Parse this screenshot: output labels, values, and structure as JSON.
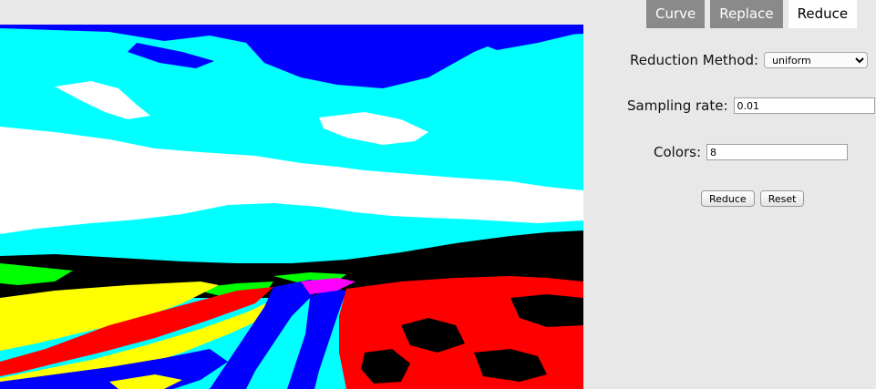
{
  "tabs": [
    {
      "label": "Curve"
    },
    {
      "label": "Replace"
    },
    {
      "label": "Reduce"
    }
  ],
  "active_tab": "Reduce",
  "form": {
    "method_label": "Reduction Method:",
    "method_value": "uniform",
    "method_options": [
      "uniform"
    ],
    "sampling_label": "Sampling rate:",
    "sampling_value": "0.01",
    "colors_label": "Colors:",
    "colors_value": "8",
    "reduce_button": "Reduce",
    "reset_button": "Reset"
  },
  "image": {
    "palette": [
      "#0000ff",
      "#00ffff",
      "#ffffff",
      "#000000",
      "#ff0000",
      "#ffff00",
      "#00ff00",
      "#ff00ff"
    ]
  }
}
